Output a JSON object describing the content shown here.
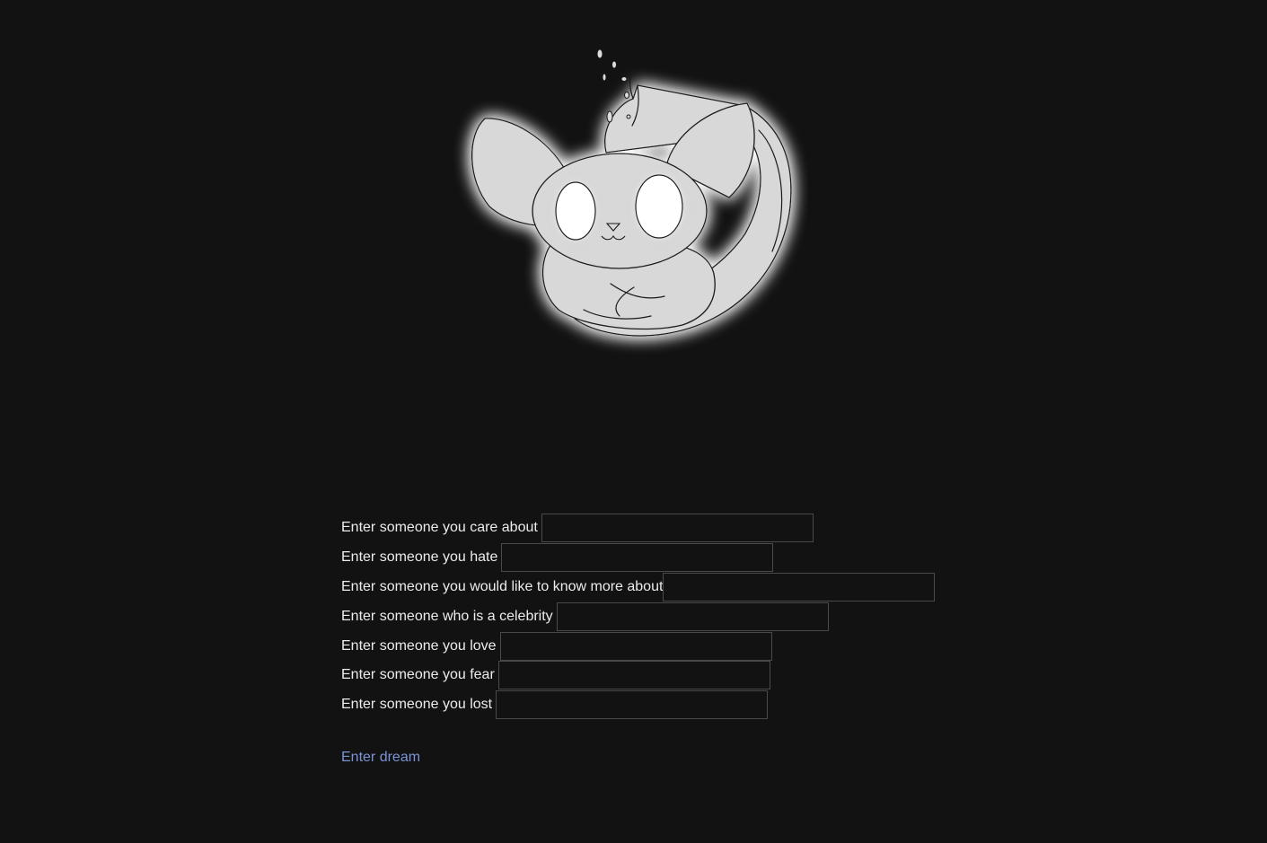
{
  "mascot": {
    "icon": "glowing-cat-creature-icon",
    "glow_color": "#ffffff",
    "body_color": "#d8d8d8"
  },
  "form": {
    "fields": [
      {
        "label": "Enter someone you care about",
        "value": "",
        "placeholder": ""
      },
      {
        "label": "Enter someone you hate",
        "value": "",
        "placeholder": ""
      },
      {
        "label": "Enter someone you would like to know more about",
        "value": "",
        "placeholder": ""
      },
      {
        "label": "Enter someone who is a celebrity",
        "value": "",
        "placeholder": ""
      },
      {
        "label": "Enter someone you love",
        "value": "",
        "placeholder": ""
      },
      {
        "label": "Enter someone you fear",
        "value": "",
        "placeholder": ""
      },
      {
        "label": "Enter someone you lost",
        "value": "",
        "placeholder": ""
      }
    ],
    "submit_label": "Enter dream"
  },
  "colors": {
    "background": "#121212",
    "text": "#ececec",
    "link": "#7b93d6",
    "input_border": "#4a4a4a"
  }
}
